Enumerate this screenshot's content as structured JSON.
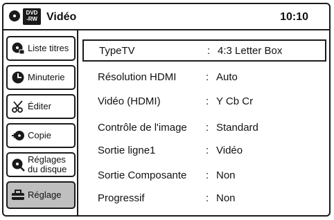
{
  "header": {
    "badge_top": "DVD",
    "badge_bottom": "-RW",
    "title": "Vidéo",
    "time": "10:10"
  },
  "sidebar": {
    "items": [
      {
        "label": "Liste titres",
        "icon": "title-list-icon"
      },
      {
        "label": "Minuterie",
        "icon": "timer-icon"
      },
      {
        "label": "Éditer",
        "icon": "scissors-icon"
      },
      {
        "label": "Copie",
        "icon": "copy-icon"
      },
      {
        "label_line1": "Réglages",
        "label_line2": "du disque",
        "icon": "disc-settings-icon"
      },
      {
        "label": "Réglage",
        "icon": "toolbox-icon",
        "active": true
      }
    ]
  },
  "settings": {
    "separator": ":",
    "rows": [
      {
        "label": "TypeTV",
        "value": "4:3 Letter Box"
      },
      {
        "label": "Résolution HDMI",
        "value": "Auto"
      },
      {
        "label": "Vidéo (HDMI)",
        "value": "Y Cb Cr"
      },
      {
        "label": "Contrôle de l'image",
        "value": "Standard"
      },
      {
        "label": "Sortie ligne1",
        "value": "Vidéo"
      },
      {
        "label": "Sortie Composante",
        "value": "Non"
      },
      {
        "label": "Progressif",
        "value": "Non"
      }
    ]
  }
}
